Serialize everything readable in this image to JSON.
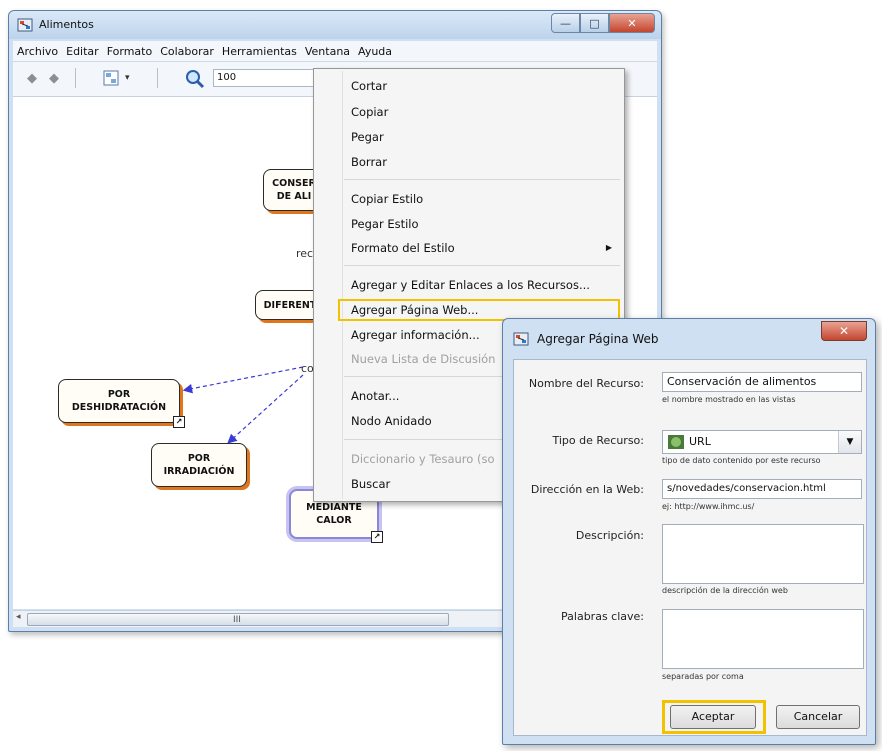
{
  "main_window": {
    "title": "Alimentos",
    "controls": {
      "minimize": "—",
      "maximize": "□",
      "close": "✕"
    }
  },
  "menubar": [
    "Archivo",
    "Editar",
    "Formato",
    "Colaborar",
    "Herramientas",
    "Ventana",
    "Ayuda"
  ],
  "toolbar": {
    "zoom_value": "100"
  },
  "canvas": {
    "nodes": {
      "conser": "CONSER\nDE ALI",
      "diferent": "DIFERENT",
      "deshidratacion": "POR\nDESHIDRATACIÓN",
      "irradiacion": "POR\nIRRADIACIÓN",
      "mediante_calor": "MEDIANTE\nCALOR"
    },
    "labels": {
      "rec": "rec",
      "co": "co"
    },
    "scroll_grip": "III"
  },
  "context_menu": {
    "items": [
      {
        "label": "Cortar",
        "enabled": true
      },
      {
        "label": "Copiar",
        "enabled": true
      },
      {
        "label": "Pegar",
        "enabled": true
      },
      {
        "label": "Borrar",
        "enabled": true
      },
      {
        "label": "Copiar Estilo",
        "enabled": true
      },
      {
        "label": "Pegar Estilo",
        "enabled": true
      },
      {
        "label": "Formato del Estilo",
        "enabled": true,
        "submenu": true
      },
      {
        "label": "Agregar y Editar Enlaces a los Recursos...",
        "enabled": true
      },
      {
        "label": "Agregar Página Web...",
        "enabled": true,
        "highlighted": true
      },
      {
        "label": "Agregar información...",
        "enabled": true
      },
      {
        "label": "Nueva Lista de Discusión",
        "enabled": false
      },
      {
        "label": "Anotar...",
        "enabled": true
      },
      {
        "label": "Nodo Anidado",
        "enabled": true
      },
      {
        "label": "Diccionario y Tesauro (so",
        "enabled": false
      },
      {
        "label": "Buscar",
        "enabled": true
      }
    ]
  },
  "dialog": {
    "title": "Agregar Página Web",
    "close": "✕",
    "fields": {
      "nombre": {
        "label": "Nombre del Recurso:",
        "value": "Conservación de alimentos",
        "hint": "el nombre mostrado en las vistas"
      },
      "tipo": {
        "label": "Tipo de Recurso:",
        "value": "URL",
        "hint": "tipo de dato contenido por este recurso"
      },
      "direccion": {
        "label": "Dirección en la Web:",
        "value": "s/novedades/conservacion.html",
        "hint": "ej: http://www.ihmc.us/"
      },
      "descripcion": {
        "label": "Descripción:",
        "hint": "descripción de la dirección web"
      },
      "palabras": {
        "label": "Palabras clave:",
        "hint": "separadas por coma"
      }
    },
    "buttons": {
      "accept": "Aceptar",
      "cancel": "Cancelar"
    }
  },
  "colors": {
    "highlight": "#f2c200",
    "node_shadow": "#e0761c",
    "arrow": "#3a3ad6"
  }
}
